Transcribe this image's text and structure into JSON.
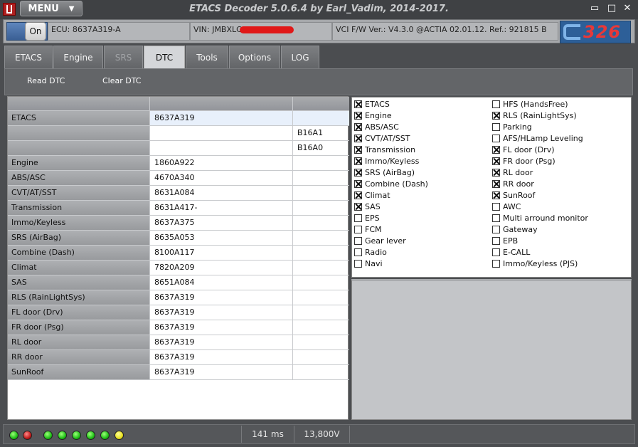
{
  "window": {
    "title": "ETACS Decoder 5.0.6.4 by Earl_Vadim, 2014-2017.",
    "menu_label": "MENU",
    "menu_arrow": "▼",
    "min_glyph": "▭",
    "max_glyph": "□",
    "close_glyph": "✕"
  },
  "infobar": {
    "on_label": "On",
    "ecu": "ECU: 8637A319-A",
    "vin": "VIN: JMBXLC",
    "vci": "VCI F/W Ver.:  V4.3.0 @ACTIA 02.01.12. Ref.: 921815  B",
    "logo_text": "326"
  },
  "tabs": [
    {
      "label": "ETACS"
    },
    {
      "label": "Engine"
    },
    {
      "label": "SRS"
    },
    {
      "label": "DTC"
    },
    {
      "label": "Tools"
    },
    {
      "label": "Options"
    },
    {
      "label": "LOG"
    }
  ],
  "toolbar": {
    "read_dtc": "Read DTC",
    "clear_dtc": "Clear DTC"
  },
  "table": {
    "rows": [
      {
        "module": "ETACS",
        "part": "8637A319",
        "dtc": ""
      },
      {
        "module": "",
        "part": "",
        "dtc": "B16A1"
      },
      {
        "module": "",
        "part": "",
        "dtc": "B16A0"
      },
      {
        "module": "Engine",
        "part": "1860A922",
        "dtc": ""
      },
      {
        "module": "ABS/ASC",
        "part": "4670A340",
        "dtc": ""
      },
      {
        "module": "CVT/AT/SST",
        "part": "8631A084",
        "dtc": ""
      },
      {
        "module": "Transmission",
        "part": "8631A417-",
        "dtc": ""
      },
      {
        "module": "Immo/Keyless",
        "part": "8637A375",
        "dtc": ""
      },
      {
        "module": "SRS (AirBag)",
        "part": "8635A053",
        "dtc": ""
      },
      {
        "module": "Combine (Dash)",
        "part": "8100A117",
        "dtc": ""
      },
      {
        "module": "Climat",
        "part": "7820A209",
        "dtc": ""
      },
      {
        "module": "SAS",
        "part": "8651A084",
        "dtc": ""
      },
      {
        "module": "RLS (RainLightSys)",
        "part": "8637A319",
        "dtc": ""
      },
      {
        "module": "FL door (Drv)",
        "part": "8637A319",
        "dtc": ""
      },
      {
        "module": "FR door (Psg)",
        "part": "8637A319",
        "dtc": ""
      },
      {
        "module": "RL door",
        "part": "8637A319",
        "dtc": ""
      },
      {
        "module": "RR door",
        "part": "8637A319",
        "dtc": ""
      },
      {
        "module": "SunRoof",
        "part": "8637A319",
        "dtc": ""
      }
    ]
  },
  "modules_left": [
    {
      "label": "ETACS",
      "checked": true
    },
    {
      "label": "Engine",
      "checked": true
    },
    {
      "label": "ABS/ASC",
      "checked": true
    },
    {
      "label": "CVT/AT/SST",
      "checked": true
    },
    {
      "label": "Transmission",
      "checked": true
    },
    {
      "label": "Immo/Keyless",
      "checked": true
    },
    {
      "label": "SRS (AirBag)",
      "checked": true
    },
    {
      "label": "Combine (Dash)",
      "checked": true
    },
    {
      "label": "Climat",
      "checked": true
    },
    {
      "label": "SAS",
      "checked": true
    },
    {
      "label": "EPS",
      "checked": false
    },
    {
      "label": "FCM",
      "checked": false
    },
    {
      "label": "Gear lever",
      "checked": false
    },
    {
      "label": "Radio",
      "checked": false
    },
    {
      "label": "Navi",
      "checked": false
    }
  ],
  "modules_right": [
    {
      "label": "HFS (HandsFree)",
      "checked": false
    },
    {
      "label": "RLS (RainLightSys)",
      "checked": true
    },
    {
      "label": "Parking",
      "checked": false
    },
    {
      "label": "AFS/HLamp Leveling",
      "checked": false
    },
    {
      "label": "FL door (Drv)",
      "checked": true
    },
    {
      "label": "FR door (Psg)",
      "checked": true
    },
    {
      "label": "RL door",
      "checked": true
    },
    {
      "label": "RR door",
      "checked": true
    },
    {
      "label": "SunRoof",
      "checked": true
    },
    {
      "label": "AWC",
      "checked": false
    },
    {
      "label": "Multi arround monitor",
      "checked": false
    },
    {
      "label": "Gateway",
      "checked": false
    },
    {
      "label": "EPB",
      "checked": false
    },
    {
      "label": "E-CALL",
      "checked": false
    },
    {
      "label": "Immo/Keyless (PJS)",
      "checked": false
    }
  ],
  "status": {
    "leds": [
      "green",
      "red",
      "green",
      "green",
      "green",
      "green",
      "green",
      "yellow"
    ],
    "latency": "141 ms",
    "voltage": "13,800V"
  }
}
